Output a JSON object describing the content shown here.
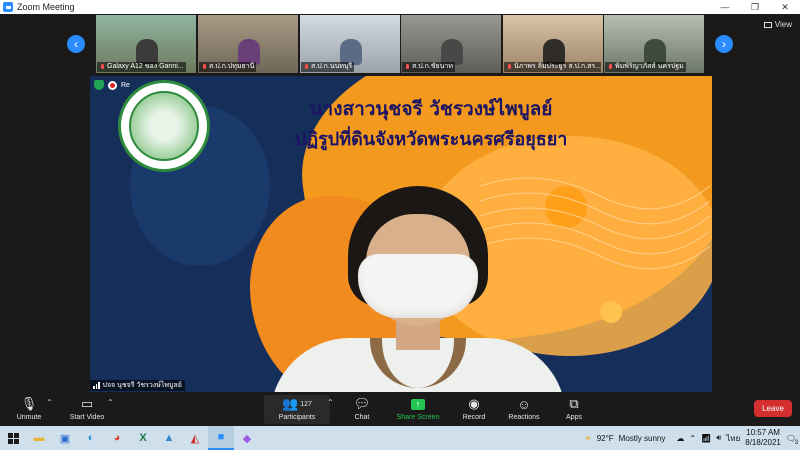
{
  "window": {
    "title": "Zoom Meeting",
    "controls": [
      "—",
      "❐",
      "✕"
    ]
  },
  "gallery": {
    "view_label": "View",
    "thumbnails": [
      {
        "name": "Galaxy A12 ของ Ganni...",
        "scene_color": "#7b8a6e"
      },
      {
        "name": "ส.ป.ก.ปทุมธานี",
        "scene_color": "#8a7f6f"
      },
      {
        "name": "ส.ป.ก.นนทบุรี",
        "scene_color": "#a7b0b8"
      },
      {
        "name": "ส.ป.ก.ชัยนาท",
        "scene_color": "#7e7c78"
      },
      {
        "name": "นิภาพร ลิ้มประยูร ส.ป.ก.สร...",
        "scene_color": "#b49e84"
      },
      {
        "name": "พิมพ์ริญาภัสส์ นครปฐม",
        "scene_color": "#8d9588"
      }
    ]
  },
  "main_video": {
    "recording_label": "Re",
    "slide_line1": "นางสาวนุชจรี วัชรวงษ์ไพบูลย์",
    "slide_line2": "ปฏิรูปที่ดินจังหวัดพระนครศรีอยุธยา",
    "speaker_name": "ปจจ นุชจรี วัชรวงษ์ไพบูลย์"
  },
  "toolbar": {
    "unmute": "Unmute",
    "start_video": "Start Video",
    "participants": "Participants",
    "participant_count": "127",
    "chat": "Chat",
    "share_screen": "Share Screen",
    "record": "Record",
    "reactions": "Reactions",
    "apps": "Apps",
    "leave": "Leave"
  },
  "taskbar": {
    "weather_temp": "92°F",
    "weather_text": "Mostly sunny",
    "language": "ไทย",
    "time": "10:57 AM",
    "date": "8/18/2021",
    "notification_count": "3"
  },
  "colors": {
    "accent": "#2d8cff",
    "leave": "#d32f2f",
    "share": "#23c552",
    "slide_orange": "#f39a1e",
    "slide_navy": "#162f5a"
  }
}
